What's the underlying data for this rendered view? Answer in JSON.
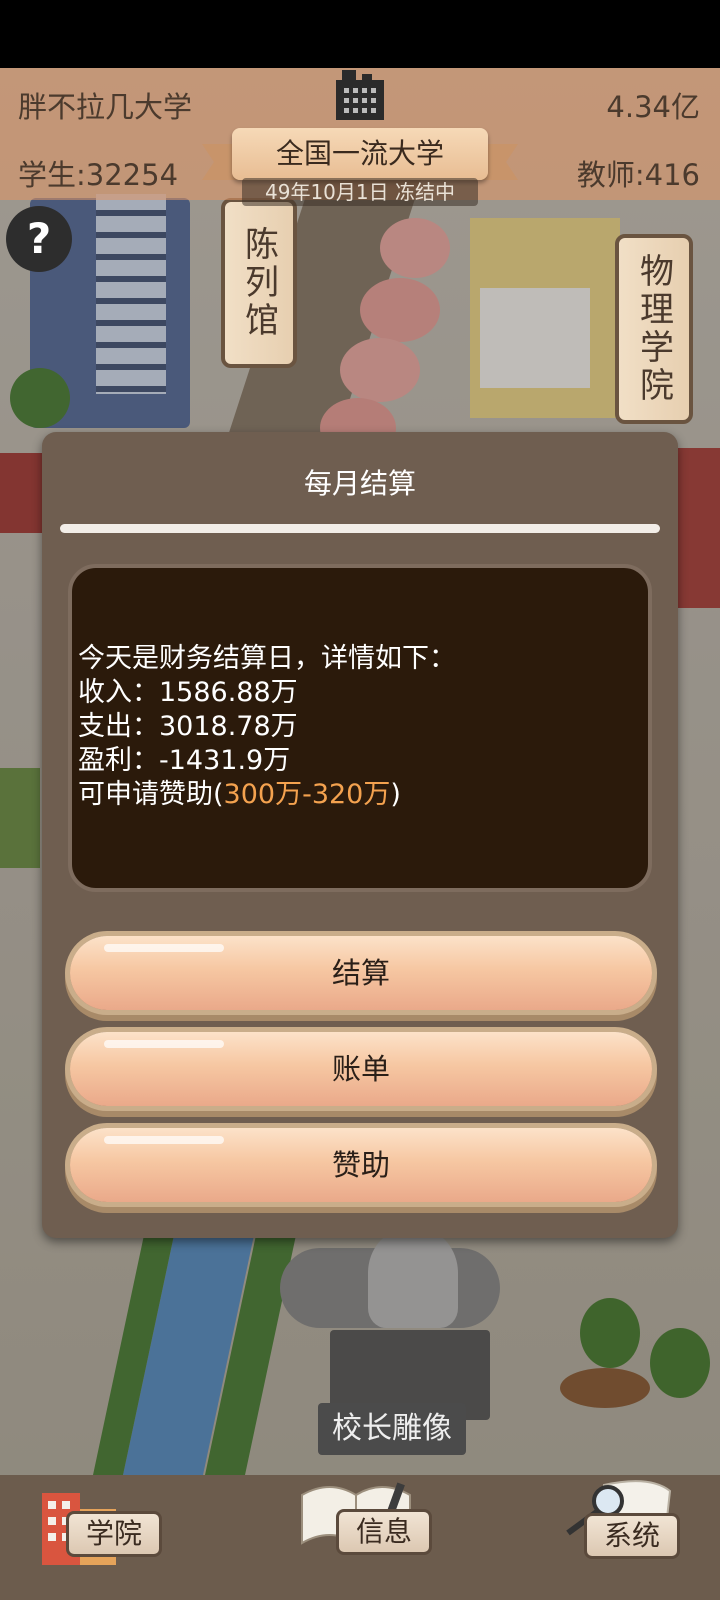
{
  "hud": {
    "university_name": "胖不拉几大学",
    "funds": "4.34亿",
    "students": "学生:32254",
    "teachers": "教师:416",
    "rank": "全国一流大学",
    "date_status": "49年10月1日 冻结中"
  },
  "help": {
    "icon": "question-mark",
    "glyph": "?"
  },
  "map": {
    "signs": [
      "陈列馆",
      "物理学院"
    ],
    "statue_label": "校长雕像"
  },
  "modal": {
    "title": "每月结算",
    "message": {
      "intro": "今天是财务结算日，详情如下：",
      "income": "收入：1586.88万",
      "expense": "支出：3018.78万",
      "profit": "盈利：-1431.9万",
      "sponsor_prefix": "可申请赞助(",
      "sponsor_range": "300万-320万",
      "sponsor_suffix": ")"
    },
    "buttons": {
      "settle": "结算",
      "bill": "账单",
      "sponsor": "赞助"
    }
  },
  "bottom_nav": {
    "items": [
      {
        "label": "学院",
        "icon": "college-building-icon"
      },
      {
        "label": "信息",
        "icon": "open-book-icon"
      },
      {
        "label": "系统",
        "icon": "magnifier-scroll-icon"
      }
    ]
  },
  "colors": {
    "modal_bg": "#6f5e50",
    "message_bg": "#2b1a0b",
    "highlight": "#f4a24f",
    "button": "#f6c7a2"
  }
}
